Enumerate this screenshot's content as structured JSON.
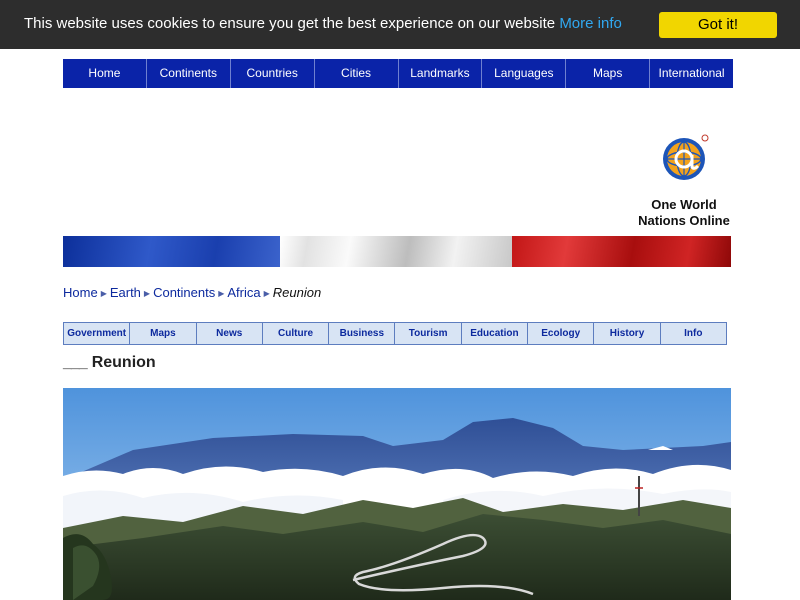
{
  "cookie_bar": {
    "message": "This website uses cookies to ensure you get the best experience on our website",
    "more_info": "More info",
    "accept_label": "Got it!"
  },
  "top_nav": {
    "items": [
      {
        "label": "Home"
      },
      {
        "label": "Continents"
      },
      {
        "label": "Countries"
      },
      {
        "label": "Cities"
      },
      {
        "label": "Landmarks"
      },
      {
        "label": "Languages"
      },
      {
        "label": "Maps"
      },
      {
        "label": "International"
      }
    ]
  },
  "logo": {
    "line1": "One World",
    "line2": "Nations Online",
    "icon": "globe-at-logo-icon"
  },
  "flag": {
    "colors": [
      "#1a3fae",
      "#f2f2f2",
      "#c21616"
    ]
  },
  "breadcrumb": {
    "items": [
      {
        "label": "Home"
      },
      {
        "label": "Earth"
      },
      {
        "label": "Continents"
      },
      {
        "label": "Africa"
      }
    ],
    "current": "Reunion"
  },
  "sub_nav": {
    "items": [
      {
        "label": "Government"
      },
      {
        "label": "Maps"
      },
      {
        "label": "News"
      },
      {
        "label": "Culture"
      },
      {
        "label": "Business"
      },
      {
        "label": "Tourism"
      },
      {
        "label": "Education"
      },
      {
        "label": "Ecology"
      },
      {
        "label": "History"
      },
      {
        "label": "Info"
      }
    ]
  },
  "page": {
    "title_prefix": "___",
    "title": "Reunion"
  },
  "colors": {
    "nav_blue": "#0a23a8",
    "cookie_bg": "#2d2d2d",
    "cookie_button": "#f1d600",
    "link_blue": "#0d2a9e",
    "subnav_bg": "#d8e4f4"
  }
}
